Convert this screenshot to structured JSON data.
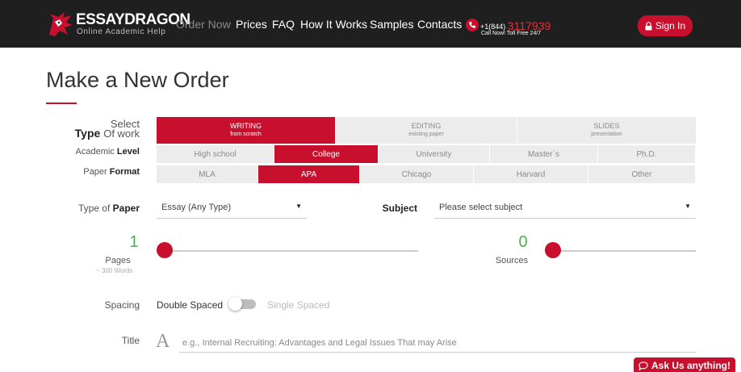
{
  "header": {
    "logo": {
      "name_part1": "ESSAY",
      "name_part2": "DRAGON",
      "tagline": "Online Academic Help"
    },
    "nav": [
      {
        "label": "Order Now"
      },
      {
        "label": "Prices"
      },
      {
        "label": "FAQ"
      },
      {
        "label": "How It Works"
      },
      {
        "label": "Samples"
      },
      {
        "label": "Contacts"
      }
    ],
    "phone": {
      "prefix": "+1(844)",
      "number": "3117939",
      "subtitle": "Call Now! Toll Free 24/7"
    },
    "signin_label": "Sign In"
  },
  "page": {
    "title": "Make a New Order"
  },
  "type_of_work": {
    "label_line1": "Select",
    "label_bold": "Type",
    "label_line2": "Of work",
    "options": [
      {
        "title": "WRITING",
        "sub": "from scratch",
        "selected": true
      },
      {
        "title": "EDITING",
        "sub": "existing paper",
        "selected": false
      },
      {
        "title": "SLIDES",
        "sub": "presentation",
        "selected": false
      }
    ]
  },
  "academic_level": {
    "label_prefix": "Academic",
    "label_bold": "Level",
    "options": [
      "High school",
      "College",
      "University",
      "Master`s",
      "Ph.D."
    ],
    "selected": "College"
  },
  "paper_format": {
    "label_prefix": "Paper",
    "label_bold": "Format",
    "options": [
      "MLA",
      "APA",
      "Chicago",
      "Harvard",
      "Other"
    ],
    "selected": "APA"
  },
  "type_of_paper": {
    "label_prefix": "Type of",
    "label_bold": "Paper",
    "value": "Essay (Any Type)"
  },
  "subject": {
    "label": "Subject",
    "value": "Please select subject"
  },
  "pages": {
    "value": "1",
    "label": "Pages",
    "sub": "~ 300 Words"
  },
  "sources": {
    "value": "0",
    "label": "Sources"
  },
  "spacing": {
    "label": "Spacing",
    "option_on": "Double Spaced",
    "option_off": "Single Spaced"
  },
  "title_field": {
    "label": "Title",
    "placeholder": "e.g., Internal Recruiting: Advantages and Legal Issues That may Arise"
  },
  "ask_label": "Ask Us anything!",
  "colors": {
    "accent": "#c8102e",
    "header_bg": "#1f1f1f",
    "counter": "#4caf50"
  }
}
